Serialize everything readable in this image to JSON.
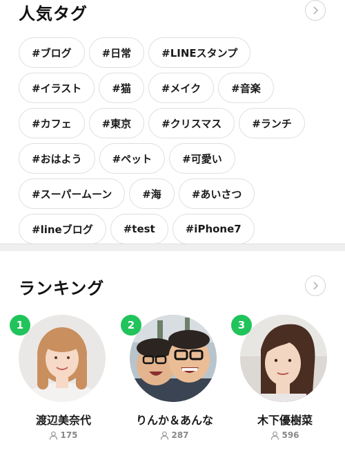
{
  "popular_tags": {
    "title": "人気タグ",
    "tags": [
      "#ブログ",
      "#日常",
      "#LINEスタンプ",
      "#イラスト",
      "#猫",
      "#メイク",
      "#音楽",
      "#カフェ",
      "#東京",
      "#クリスマス",
      "#ランチ",
      "#おはよう",
      "#ペット",
      "#可愛い",
      "#スーパームーン",
      "#海",
      "#あいさつ",
      "#lineブログ",
      "#test",
      "#iPhone7"
    ]
  },
  "ranking": {
    "title": "ランキング",
    "items": [
      {
        "rank": "1",
        "name": "渡辺美奈代",
        "followers": "175"
      },
      {
        "rank": "2",
        "name": "りんか＆あんな",
        "followers": "287"
      },
      {
        "rank": "3",
        "name": "木下優樹菜",
        "followers": "596"
      }
    ]
  },
  "colors": {
    "rank_badge": "#21c35b",
    "tag_border": "#dedede",
    "muted_text": "#888888"
  },
  "icons": {
    "more": "chevron-right-icon",
    "followers": "person-icon"
  }
}
